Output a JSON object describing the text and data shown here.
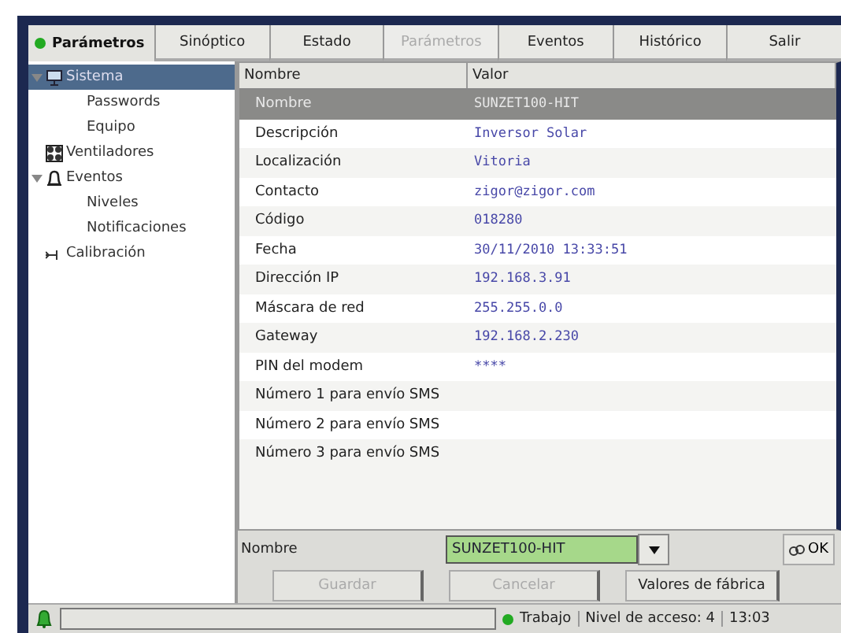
{
  "header": {
    "title": "Parámetros"
  },
  "tabs": [
    {
      "label": "Sinóptico",
      "selected": false
    },
    {
      "label": "Estado",
      "selected": false
    },
    {
      "label": "Parámetros",
      "selected": true
    },
    {
      "label": "Eventos",
      "selected": false
    },
    {
      "label": "Histórico",
      "selected": false
    },
    {
      "label": "Salir",
      "selected": false
    }
  ],
  "tree": [
    {
      "label": "Sistema",
      "kind": "system",
      "selected": true,
      "expanded": true,
      "children": [
        {
          "label": "Passwords",
          "selected": false
        },
        {
          "label": "Equipo",
          "selected": false
        }
      ]
    },
    {
      "label": "Ventiladores",
      "kind": "fan",
      "selected": false
    },
    {
      "label": "Eventos",
      "kind": "bell",
      "selected": false,
      "expanded": true,
      "children": [
        {
          "label": "Niveles",
          "selected": false
        },
        {
          "label": "Notificaciones",
          "selected": false
        }
      ]
    },
    {
      "label": "Calibración",
      "kind": "calib",
      "selected": false
    }
  ],
  "table": {
    "columns": [
      "Nombre",
      "Valor"
    ],
    "rows": [
      {
        "name": "Nombre",
        "value": "SUNZET100-HIT",
        "selected": true
      },
      {
        "name": "Descripción",
        "value": "Inversor Solar",
        "selected": false
      },
      {
        "name": "Localización",
        "value": "Vitoria",
        "selected": false
      },
      {
        "name": "Contacto",
        "value": "zigor@zigor.com",
        "selected": false
      },
      {
        "name": "Código",
        "value": "018280",
        "selected": false
      },
      {
        "name": "Fecha",
        "value": "30/11/2010 13:33:51",
        "selected": false
      },
      {
        "name": "Dirección IP",
        "value": "192.168.3.91",
        "selected": false
      },
      {
        "name": "Máscara de red",
        "value": "255.255.0.0",
        "selected": false
      },
      {
        "name": "Gateway",
        "value": "192.168.2.230",
        "selected": false
      },
      {
        "name": "PIN del modem",
        "value": "****",
        "selected": false
      },
      {
        "name": "Número 1 para envío SMS",
        "selected": false
      },
      {
        "name": "Número 2 para envío SMS",
        "selected": false
      },
      {
        "name": "Número 3 para envío SMS",
        "selected": false
      }
    ]
  },
  "editor": {
    "label": "Nombre",
    "value": "SUNZET100-HIT",
    "ok": "OK"
  },
  "buttons": [
    {
      "label": "Guardar",
      "disabled": true
    },
    {
      "label": "Cancelar",
      "disabled": true
    },
    {
      "label": "Valores de fábrica",
      "disabled": false
    }
  ],
  "status_bar": {
    "progress": {
      "level": 0
    },
    "state": "Trabajo",
    "access": "Nivel de acceso: 4",
    "time": "13:03"
  }
}
